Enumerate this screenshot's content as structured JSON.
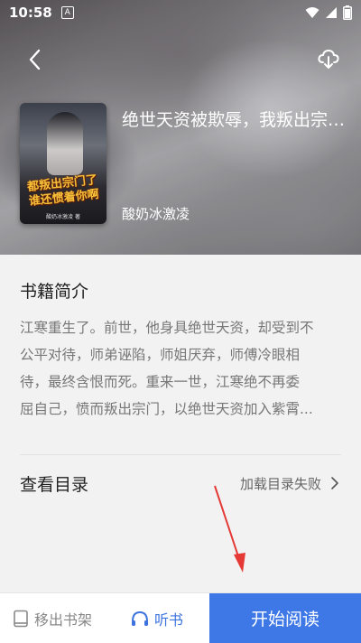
{
  "status_bar": {
    "time": "10:58",
    "notification": "A"
  },
  "book": {
    "title": "绝世天资被欺辱，我叛出宗门了",
    "author": "酸奶冰激凌",
    "cover_art_text": "都叛出宗门了\n谁还惯着你啊",
    "cover_sub": "酸奶冰激凌 著"
  },
  "intro": {
    "heading": "书籍简介",
    "lines": [
      "江寒重生了。前世，他身具绝世天资，却受到不",
      "公平对待，师弟诬陷，师姐厌弃，师傅冷眼相",
      "待，最终含恨而死。重来一世，江寒绝不再委",
      "屈自己，愤而叛出宗门，以绝世天资加入紫霄..."
    ]
  },
  "catalog": {
    "label": "查看目录",
    "status": "加载目录失败"
  },
  "bottom_bar": {
    "remove_shelf": "移出书架",
    "listen": "听书",
    "start_read": "开始阅读"
  },
  "colors": {
    "accent": "#3e78e6",
    "listen": "#3e74e0",
    "arrow": "#e53935"
  }
}
